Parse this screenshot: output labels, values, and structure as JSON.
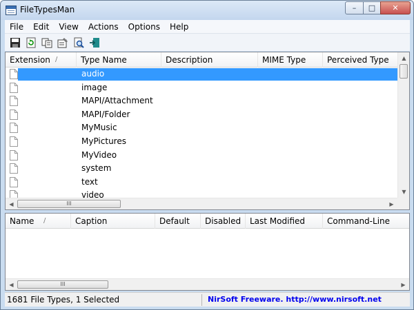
{
  "window": {
    "title": "FileTypesMan",
    "controls": {
      "minimize": "–",
      "maximize": "□",
      "close": "✕"
    }
  },
  "menu": [
    "File",
    "Edit",
    "View",
    "Actions",
    "Options",
    "Help"
  ],
  "toolbar": [
    "save-icon",
    "refresh-icon",
    "copy-icon",
    "properties-icon",
    "find-icon",
    "exit-icon"
  ],
  "top_list": {
    "columns": [
      "Extension",
      "Type Name",
      "Description",
      "MIME Type",
      "Perceived Type"
    ],
    "sort_indicator": "/",
    "rows": [
      "audio",
      "image",
      "MAPI/Attachment",
      "MAPI/Folder",
      "MyMusic",
      "MyPictures",
      "MyVideo",
      "system",
      "text",
      "video"
    ],
    "selected_index": 0
  },
  "bottom_list": {
    "columns": [
      "Name",
      "Caption",
      "Default",
      "Disabled",
      "Last Modified",
      "Command-Line"
    ],
    "sort_indicator": "/"
  },
  "scrollbar": {
    "up": "▲",
    "down": "▼",
    "left": "◀",
    "right": "▶",
    "grip": "III"
  },
  "status": {
    "summary": "1681 File Types, 1 Selected",
    "link": "NirSoft Freeware.  http://www.nirsoft.net"
  },
  "colors": {
    "selection": "#3399ff",
    "link": "#0000ee",
    "titlebar": "#c9dcf0"
  }
}
